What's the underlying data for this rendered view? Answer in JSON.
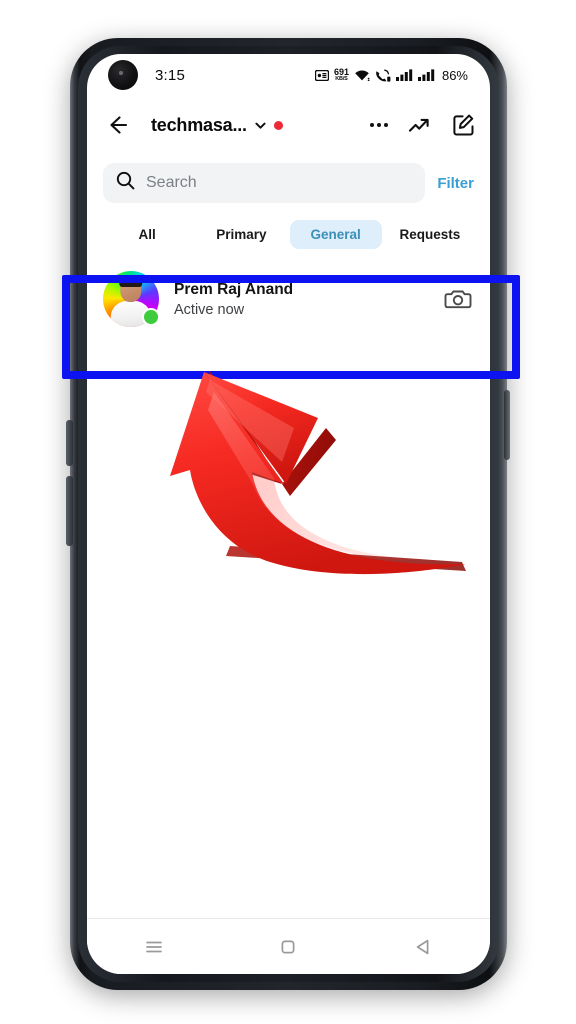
{
  "status_bar": {
    "time": "3:15",
    "network_speed_value": "691",
    "network_speed_unit": "KB/S",
    "battery_percent": "86%",
    "icons": [
      "vpn-icon",
      "network-speed-icon",
      "wifi-icon",
      "vibrate-call-icon",
      "signal-bars-icon-1",
      "signal-bars-icon-2"
    ]
  },
  "header": {
    "back_icon": "back-arrow-icon",
    "username": "techmasa...",
    "chevron_icon": "chevron-down-icon",
    "status_dot_color": "#ED2A36",
    "menu_icon": "three-dots-icon",
    "trending_icon": "trending-up-icon",
    "compose_icon": "compose-edit-icon"
  },
  "search": {
    "icon": "search-icon",
    "value": "",
    "placeholder": "Search",
    "filter_label": "Filter",
    "filter_color": "#3B9FD4"
  },
  "tabs": [
    {
      "label": "All",
      "active": false
    },
    {
      "label": "Primary",
      "active": false
    },
    {
      "label": "General",
      "active": true
    },
    {
      "label": "Requests",
      "active": false
    }
  ],
  "tab_active_bg": "#DEEEFA",
  "tab_active_text": "#3C8FB8",
  "chat_list": [
    {
      "name": "Prem Raj Anand",
      "status": "Active now",
      "online": true,
      "online_dot_color": "#3ECB3E",
      "avatar": "rainbow-gradient-profile-photo",
      "action_icon": "camera-icon"
    }
  ],
  "nav_bar": {
    "recents_icon": "hamburger-recents-icon",
    "home_icon": "home-square-icon",
    "back_icon": "back-triangle-icon"
  },
  "annotations": {
    "highlight_box": {
      "color": "#0C12F0",
      "target": "chat-row-prem-raj-anand"
    },
    "arrow": {
      "color": "#EE2222",
      "direction": "up-left",
      "points_to": "chat-row-prem-raj-anand"
    }
  }
}
